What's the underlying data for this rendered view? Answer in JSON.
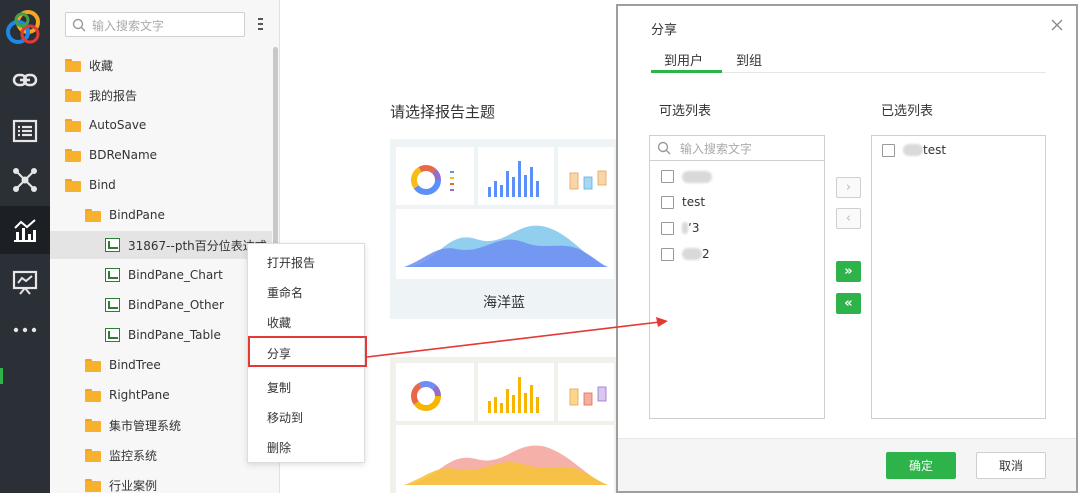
{
  "tree": {
    "search_placeholder": "输入搜索文字",
    "items": [
      {
        "label": "收藏",
        "type": "folder"
      },
      {
        "label": "我的报告",
        "type": "folder"
      },
      {
        "label": "AutoSave",
        "type": "folder"
      },
      {
        "label": "BDReName",
        "type": "folder"
      },
      {
        "label": "Bind",
        "type": "folder"
      },
      {
        "label": "BindPane",
        "type": "folder"
      },
      {
        "label": "31867--pth百分位表达式",
        "type": "report"
      },
      {
        "label": "BindPane_Chart",
        "type": "report"
      },
      {
        "label": "BindPane_Other",
        "type": "report"
      },
      {
        "label": "BindPane_Table",
        "type": "report"
      },
      {
        "label": "BindTree",
        "type": "folder"
      },
      {
        "label": "RightPane",
        "type": "folder"
      },
      {
        "label": "集市管理系统",
        "type": "folder"
      },
      {
        "label": "监控系统",
        "type": "folder"
      },
      {
        "label": "行业案例",
        "type": "folder"
      }
    ]
  },
  "context_menu": {
    "items": [
      "打开报告",
      "重命名",
      "收藏",
      "分享",
      "复制",
      "移动到",
      "删除"
    ],
    "highlighted": "分享"
  },
  "main": {
    "title": "请选择报告主题",
    "theme1_name": "海洋蓝"
  },
  "dialog": {
    "title": "分享",
    "tabs": [
      "到用户",
      "到组"
    ],
    "available_label": "可选列表",
    "selected_label": "已选列表",
    "search_placeholder": "输入搜索文字",
    "available_items": [
      "",
      "test",
      "ʼ3",
      "2"
    ],
    "selected_items": [
      "test"
    ],
    "ok": "确定",
    "cancel": "取消"
  },
  "colors": {
    "accent": "#2db34a",
    "rail": "#2b3036",
    "highlight": "#e53935",
    "folder": "#f7b12c"
  }
}
